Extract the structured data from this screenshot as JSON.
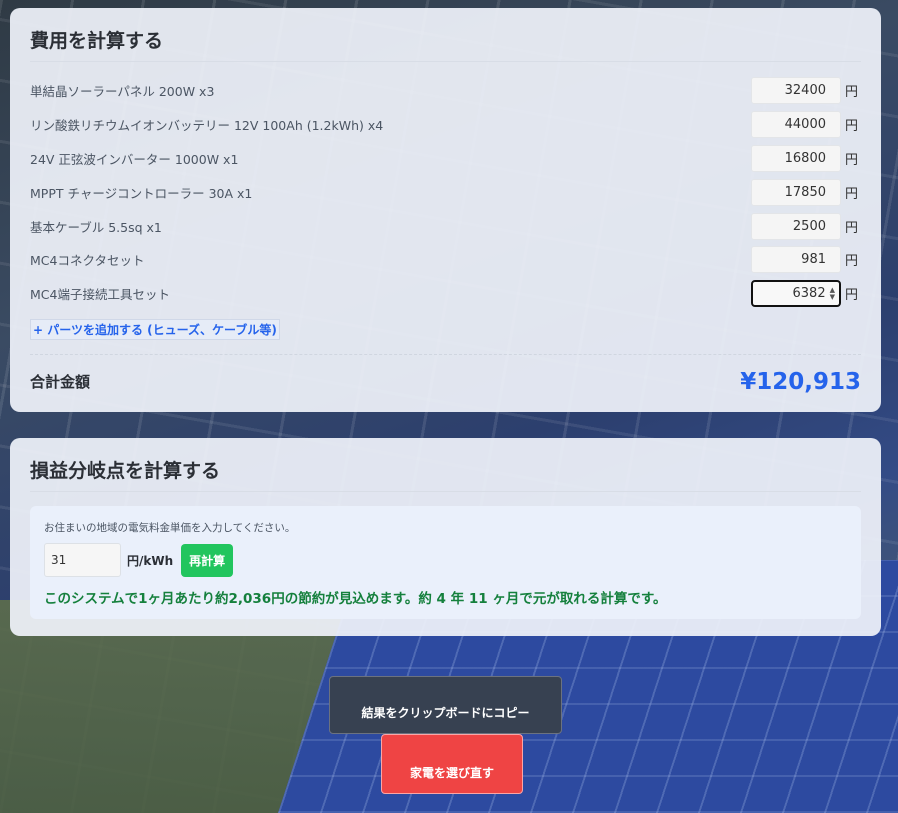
{
  "cost": {
    "title": "費用を計算する",
    "items": [
      {
        "label": "単結晶ソーラーパネル 200W x3",
        "value": "32400"
      },
      {
        "label": "リン酸鉄リチウムイオンバッテリー 12V 100Ah (1.2kWh) x4",
        "value": "44000"
      },
      {
        "label": "24V 正弦波インバーター 1000W x1",
        "value": "16800"
      },
      {
        "label": "MPPT チャージコントローラー 30A x1",
        "value": "17850"
      },
      {
        "label": "基本ケーブル 5.5sq x1",
        "value": "2500"
      },
      {
        "label": "MC4コネクタセット",
        "value": "981"
      },
      {
        "label": "MC4端子接続工具セット",
        "value": "6382"
      }
    ],
    "unit": "円",
    "add_parts_label": "+ パーツを追加する (ヒューズ、ケーブル等)",
    "total_label": "合計金額",
    "total_value": "¥120,913"
  },
  "breakeven": {
    "title": "損益分岐点を計算する",
    "hint": "お住まいの地域の電気料金単価を入力してください。",
    "rate_value": "31",
    "rate_unit": "円/kWh",
    "recalc_label": "再計算",
    "result": "このシステムで1ヶ月あたり約2,036円の節約が見込めます。約 4 年 11 ヶ月で元が取れる計算です。"
  },
  "actions": {
    "copy_label": "結果をクリップボードにコピー",
    "reselect_label": "家電を選び直す"
  },
  "colors": {
    "accent": "#2563eb",
    "success": "#22c55e",
    "danger": "#ef4444",
    "dark": "#374151"
  }
}
